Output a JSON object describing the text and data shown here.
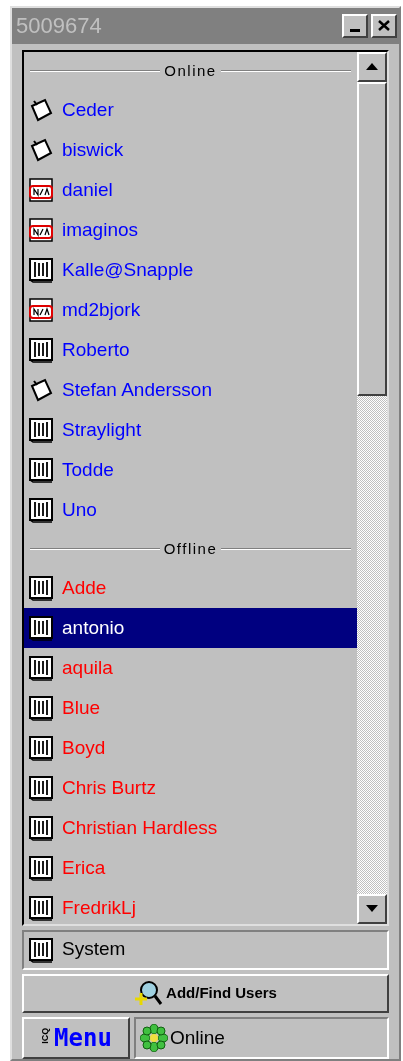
{
  "window": {
    "title": "5009674"
  },
  "contact_list": {
    "groups": [
      {
        "label": "Online",
        "kind": "online",
        "contacts": [
          {
            "name": "Ceder",
            "kind": "away",
            "selected": false
          },
          {
            "name": "biswick",
            "kind": "away",
            "selected": false
          },
          {
            "name": "daniel",
            "kind": "na",
            "selected": false
          },
          {
            "name": "imaginos",
            "kind": "na",
            "selected": false
          },
          {
            "name": "Kalle@Snapple",
            "kind": "plain",
            "selected": false
          },
          {
            "name": "md2bjork",
            "kind": "na",
            "selected": false
          },
          {
            "name": "Roberto",
            "kind": "plain",
            "selected": false
          },
          {
            "name": "Stefan Andersson",
            "kind": "away",
            "selected": false
          },
          {
            "name": "Straylight",
            "kind": "plain",
            "selected": false
          },
          {
            "name": "Todde",
            "kind": "plain",
            "selected": false
          },
          {
            "name": "Uno",
            "kind": "plain",
            "selected": false
          }
        ]
      },
      {
        "label": "Offline",
        "kind": "offline",
        "contacts": [
          {
            "name": "Adde",
            "kind": "plain",
            "selected": false
          },
          {
            "name": "antonio",
            "kind": "plain",
            "selected": true
          },
          {
            "name": "aquila",
            "kind": "plain",
            "selected": false
          },
          {
            "name": "Blue",
            "kind": "plain",
            "selected": false
          },
          {
            "name": "Boyd",
            "kind": "plain",
            "selected": false
          },
          {
            "name": "Chris Burtz",
            "kind": "plain",
            "selected": false
          },
          {
            "name": "Christian Hardless",
            "kind": "plain",
            "selected": false
          },
          {
            "name": "Erica",
            "kind": "plain",
            "selected": false
          },
          {
            "name": "FredrikLj",
            "kind": "plain",
            "selected": false
          }
        ]
      }
    ]
  },
  "system": {
    "label": "System"
  },
  "add_find_button": {
    "label": "Add/Find Users"
  },
  "menu_button": {
    "logo": "ICQ",
    "label": "Menu"
  },
  "status": {
    "label": "Online"
  }
}
